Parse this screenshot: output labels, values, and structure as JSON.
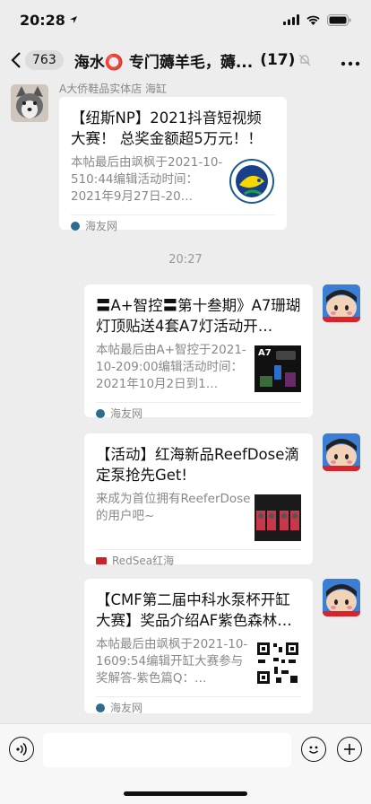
{
  "status_bar": {
    "time": "20:28"
  },
  "nav": {
    "unread_count": "763",
    "title": "海水⭕ 专门薅羊毛，薅...",
    "member_count": "(17)"
  },
  "messages": [
    {
      "sender": "A大侨鞋品实体店 海缸",
      "title": "【纽斯NP】2021抖音短视频大赛！ 总奖金额超5万元！！",
      "desc": "本帖最后由飒枫于2021-10-510:44编辑活动时间：2021年9月27日-20…",
      "source": "海友网"
    },
    {
      "title": "〓A+智控〓第十叁期》A7珊瑚灯顶贴送4套A7灯活动开…",
      "desc": "本帖最后由A+智控于2021-10-209:00编辑活动时间：2021年10月2日到1…",
      "thumb_label": "A7",
      "source": "海友网"
    },
    {
      "title": "【活动】红海新品ReefDose滴定泵抢先Get!",
      "desc": "来成为首位拥有ReeferDose的用户吧~",
      "source": "RedSea红海"
    },
    {
      "title": "【CMF第二届中科水泵杯开缸大赛】奖品介绍AF紫色森林…",
      "desc": "本帖最后由飒枫于2021-10-1609:54编辑开缸大赛参与奖解答-紫色篇Q：…",
      "source": "海友网"
    }
  ],
  "timestamp": "20:27"
}
